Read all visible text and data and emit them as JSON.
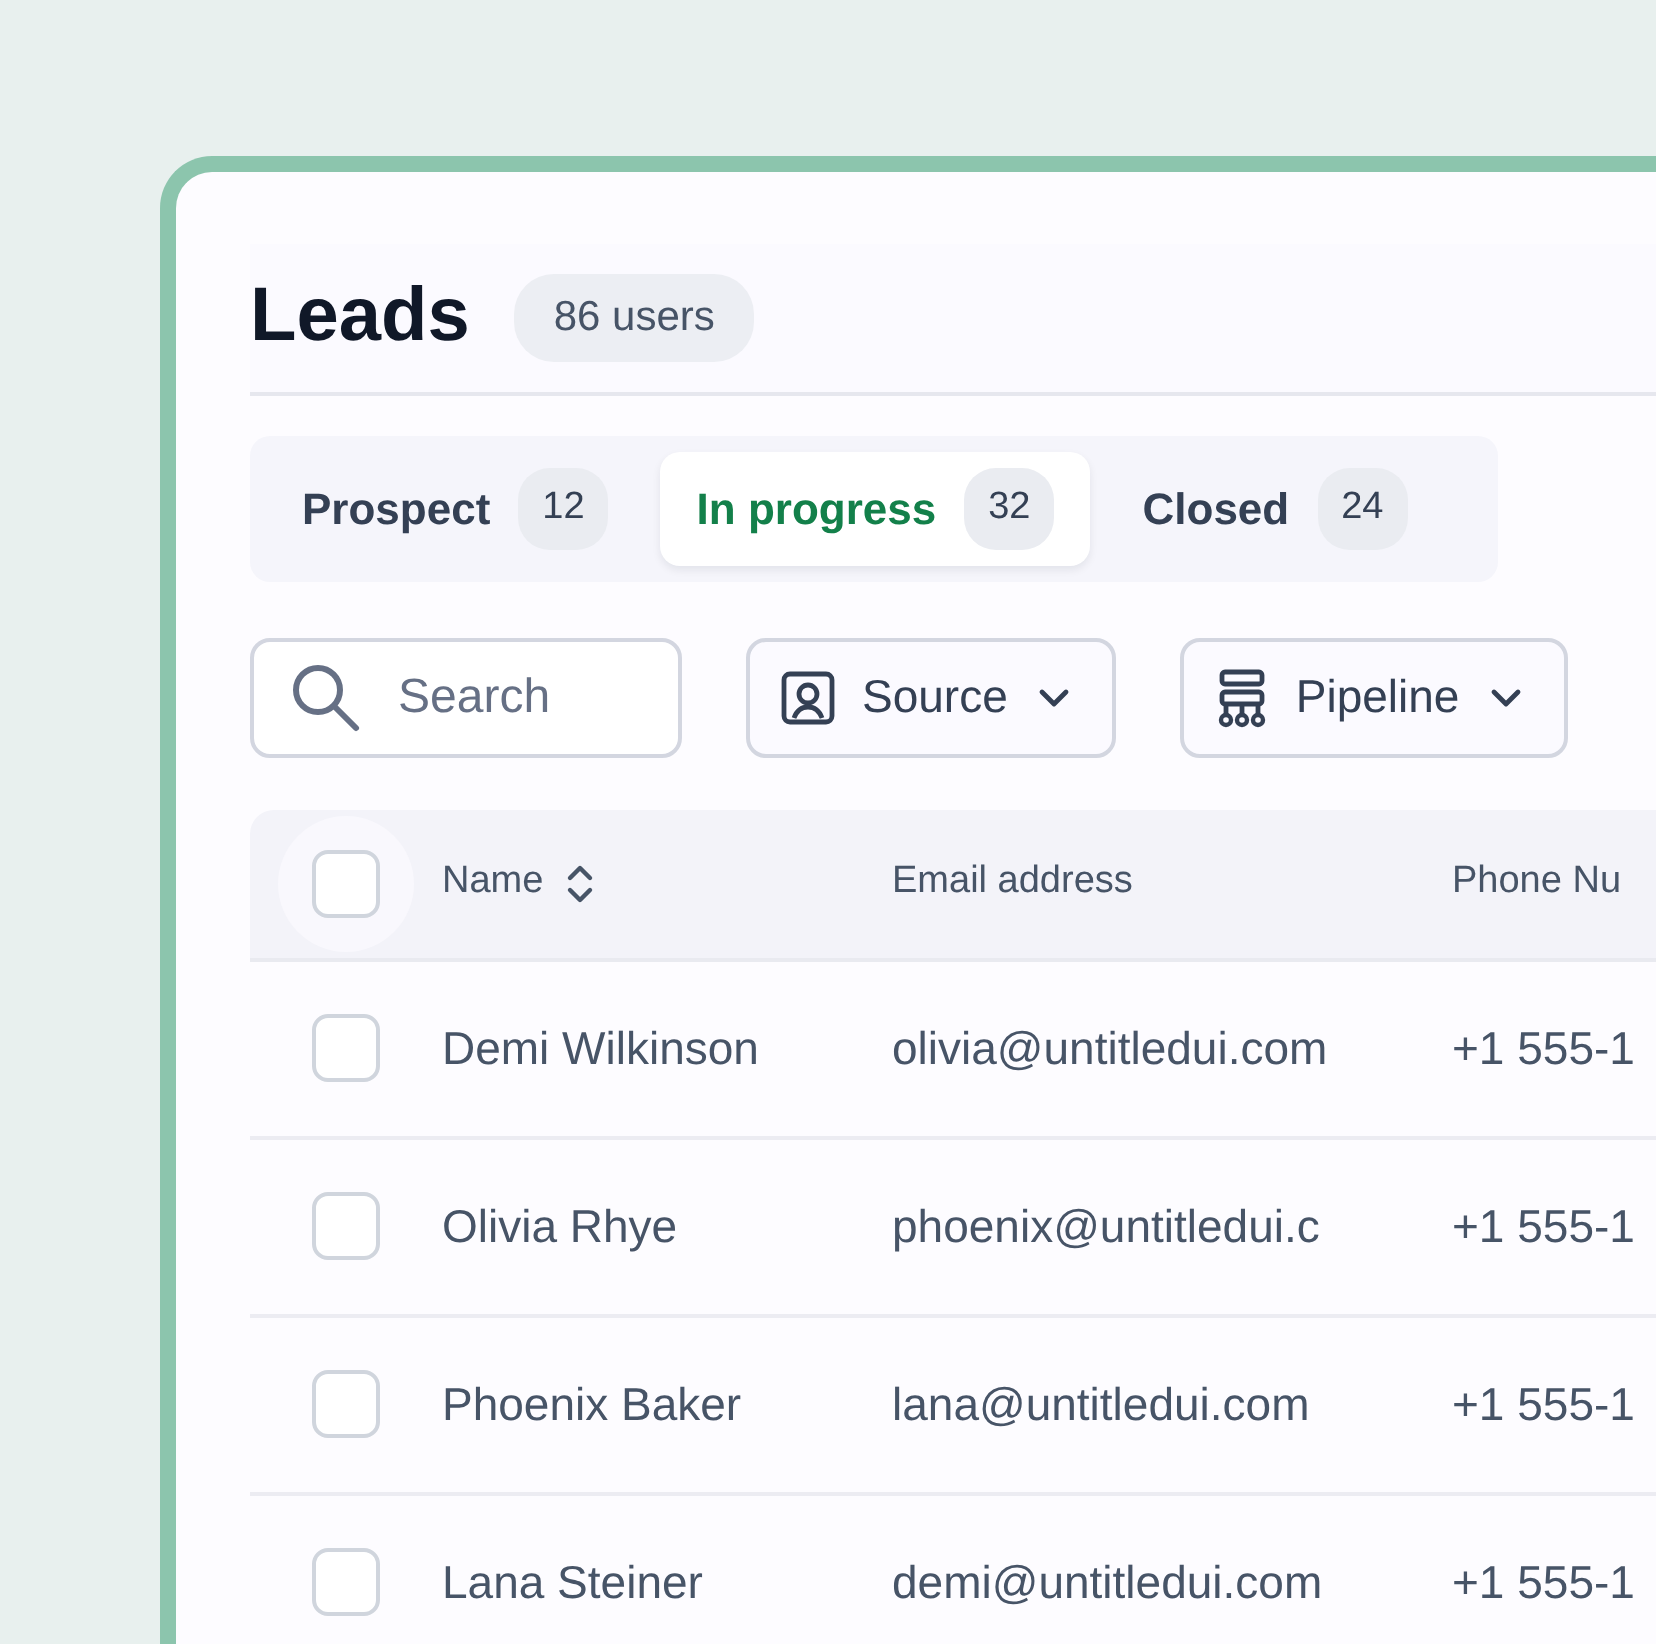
{
  "header": {
    "title": "Leads",
    "count": "86 users"
  },
  "tabs": [
    {
      "label": "Prospect",
      "count": "12",
      "selected": false
    },
    {
      "label": "In progress",
      "count": "32",
      "selected": true
    },
    {
      "label": "Closed",
      "count": "24",
      "selected": false
    }
  ],
  "search": {
    "placeholder": "Search"
  },
  "filters": [
    {
      "kind": "source",
      "label": "Source"
    },
    {
      "kind": "pipeline",
      "label": "Pipeline"
    }
  ],
  "table": {
    "select_all": {
      "checked": false
    },
    "columns": [
      "Name",
      "Email address",
      "Phone Nu"
    ],
    "rows": [
      {
        "checked": false,
        "cells": [
          "Demi Wilkinson",
          "olivia@untitledui.com",
          "+1 555-1"
        ]
      },
      {
        "checked": false,
        "cells": [
          "Olivia Rhye",
          "phoenix@untitledui.c",
          "+1 555-1"
        ]
      },
      {
        "checked": false,
        "cells": [
          "Phoenix Baker",
          "lana@untitledui.com",
          "+1 555-1"
        ]
      },
      {
        "checked": false,
        "cells": [
          "Lana Steiner",
          "demi@untitledui.com",
          "+1 555-1"
        ]
      }
    ]
  }
}
